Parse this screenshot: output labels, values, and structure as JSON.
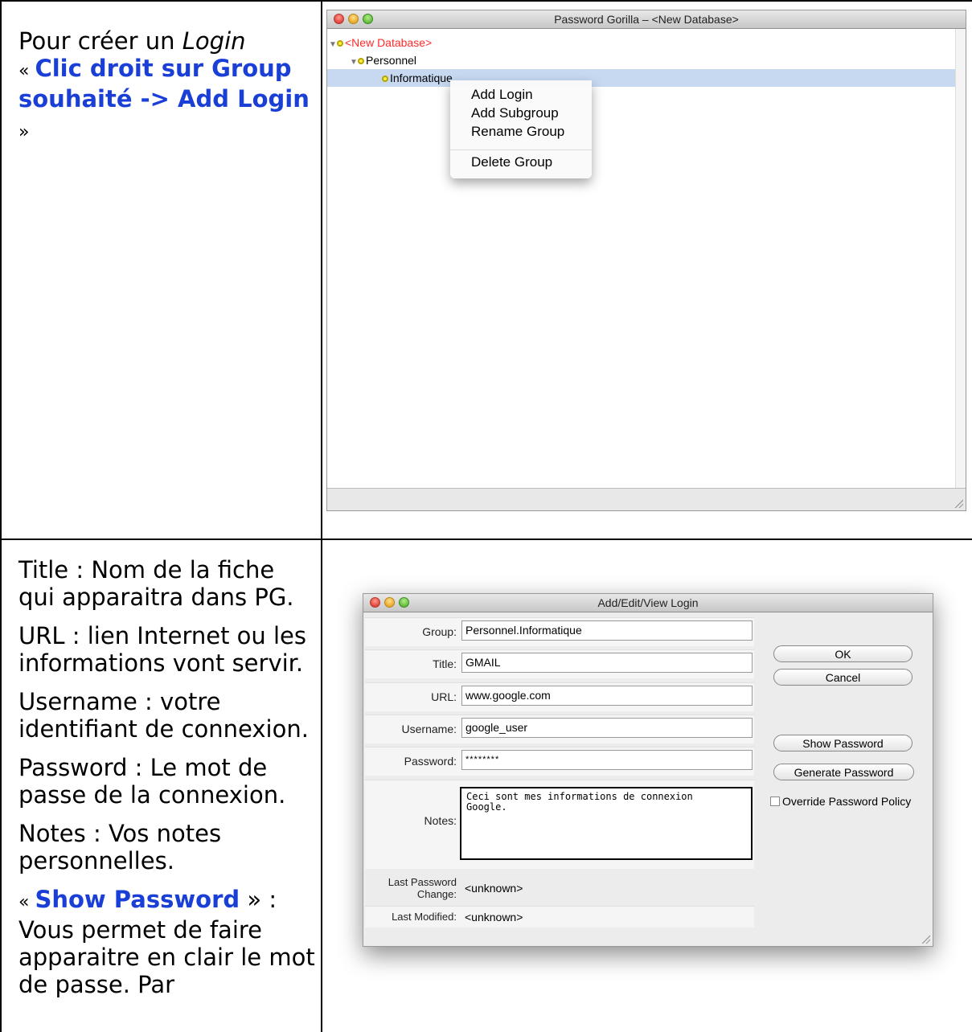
{
  "cell1": {
    "intro_prefix": "Pour créer un ",
    "intro_italic": "Login",
    "quote_open": "« ",
    "instruction": "Clic droit sur Group souhaité -> Add Login",
    "quote_close": " »"
  },
  "tree_window": {
    "title": "Password Gorilla – <New Database>",
    "tree": [
      {
        "label": "<New Database>",
        "color": "#ff2a2a"
      },
      {
        "label": "Personnel",
        "color": "#000000"
      },
      {
        "label": "Informatique",
        "color": "#000000"
      }
    ],
    "context_menu": [
      "Add Login",
      "Add Subgroup",
      "Rename Group",
      "Delete Group"
    ]
  },
  "cell2": {
    "p1": "Title : Nom de la fiche qui apparaitra dans PG.",
    "p2": "URL : lien Internet ou les informations vont servir.",
    "p3": "Username : votre identifiant de connexion.",
    "p4": "Password : Le mot de passe de la connexion.",
    "p5": "Notes : Vos notes personnelles.",
    "p6_open": "« ",
    "p6_kw": "Show Password",
    "p6_rest": " » : Vous permet de faire apparaitre en clair le mot de passe. Par"
  },
  "login_window": {
    "title": "Add/Edit/View Login",
    "fields": {
      "group": {
        "label": "Group:",
        "value": "Personnel.Informatique"
      },
      "title": {
        "label": "Title:",
        "value": "GMAIL"
      },
      "url": {
        "label": "URL:",
        "value": "www.google.com"
      },
      "username": {
        "label": "Username:",
        "value": "google_user"
      },
      "password": {
        "label": "Password:",
        "value": "********"
      },
      "notes": {
        "label": "Notes:",
        "value": "Ceci sont mes informations de connexion\nGoogle."
      }
    },
    "last_password_change": {
      "label_line1": "Last Password",
      "label_line2": "Change:",
      "value": "<unknown>"
    },
    "last_modified": {
      "label": "Last Modified:",
      "value": "<unknown>"
    },
    "buttons": {
      "ok": "OK",
      "cancel": "Cancel",
      "show_password": "Show Password",
      "generate_password": "Generate Password"
    },
    "override_policy_label": "Override Password Policy"
  }
}
